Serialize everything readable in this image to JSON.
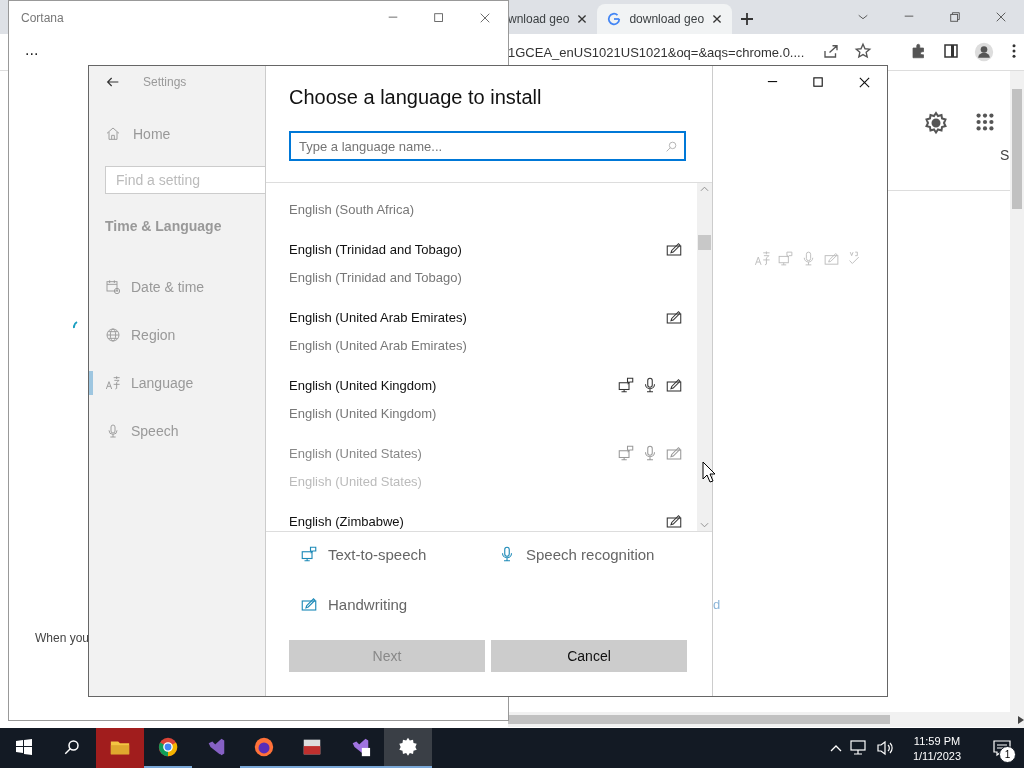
{
  "browser": {
    "tabs": [
      {
        "title": "wnload geo",
        "selected": false
      },
      {
        "title": "download geo",
        "selected": true
      }
    ],
    "address": "1GCEA_enUS1021US1021&oq=&aqs=chrome.0....",
    "page_letter": "S"
  },
  "cortana": {
    "title": "Cortana",
    "more": "...",
    "footer": "When you"
  },
  "settings": {
    "title": "Settings",
    "home": "Home",
    "search_placeholder": "Find a setting",
    "section": "Time & Language",
    "nav": [
      {
        "label": "Date & time",
        "kind": "calendar",
        "selected": false
      },
      {
        "label": "Region",
        "kind": "globe",
        "selected": false
      },
      {
        "label": "Language",
        "kind": "language",
        "selected": true
      },
      {
        "label": "Speech",
        "kind": "mic",
        "selected": false
      }
    ],
    "partial_text": "d"
  },
  "dialog": {
    "title": "Choose a language to install",
    "search_placeholder": "Type a language name...",
    "languages": [
      {
        "native": "English (South Africa)",
        "disabled": false
      },
      {
        "name": "English (Trinidad and Tobago)",
        "native": "English (Trinidad and Tobago)",
        "disabled": false,
        "text_to_speech": false,
        "speech_recognition": false,
        "handwriting": true
      },
      {
        "name": "English (United Arab Emirates)",
        "native": "English (United Arab Emirates)",
        "disabled": false,
        "text_to_speech": false,
        "speech_recognition": false,
        "handwriting": true
      },
      {
        "name": "English (United Kingdom)",
        "native": "English (United Kingdom)",
        "disabled": false,
        "text_to_speech": true,
        "speech_recognition": true,
        "handwriting": true
      },
      {
        "name": "English (United States)",
        "native": "English (United States)",
        "disabled": true,
        "text_to_speech": true,
        "speech_recognition": true,
        "handwriting": true
      },
      {
        "name": "English (Zimbabwe)",
        "disabled": false,
        "text_to_speech": false,
        "speech_recognition": false,
        "handwriting": true
      }
    ],
    "legend": [
      {
        "kind": "tts",
        "label": "Text-to-speech"
      },
      {
        "kind": "mic",
        "label": "Speech recognition"
      },
      {
        "kind": "pen",
        "label": "Handwriting"
      }
    ],
    "buttons": [
      {
        "label": "Next",
        "disabled": true
      },
      {
        "label": "Cancel",
        "disabled": false
      }
    ]
  },
  "taskbar": {
    "apps": [
      {
        "kind": "explorer",
        "running": false,
        "active": false
      },
      {
        "kind": "chrome",
        "running": true,
        "active": false
      },
      {
        "kind": "vs",
        "running": false,
        "active": false
      },
      {
        "kind": "firefox",
        "running": true,
        "active": false
      },
      {
        "kind": "toolbox",
        "running": true,
        "active": false
      },
      {
        "kind": "vsb",
        "running": true,
        "active": false
      },
      {
        "kind": "settings",
        "running": true,
        "active": true
      }
    ],
    "time": "11:59 PM",
    "date": "1/11/2023",
    "notifications": "1"
  }
}
